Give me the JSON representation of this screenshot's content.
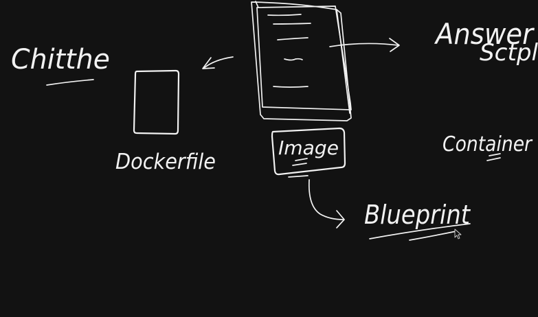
{
  "theme": {
    "background": "#121212",
    "ink": "#f2f2f2"
  },
  "labels": {
    "chitthe": "Chitthe",
    "dockerfile": "Dockerfile",
    "image": "Image",
    "answer": "Answer",
    "answer_line2": "Sctpl",
    "container": "Container",
    "blueprint": "Blueprint"
  },
  "icons": {
    "cursor": "mouse-pointer-icon"
  }
}
